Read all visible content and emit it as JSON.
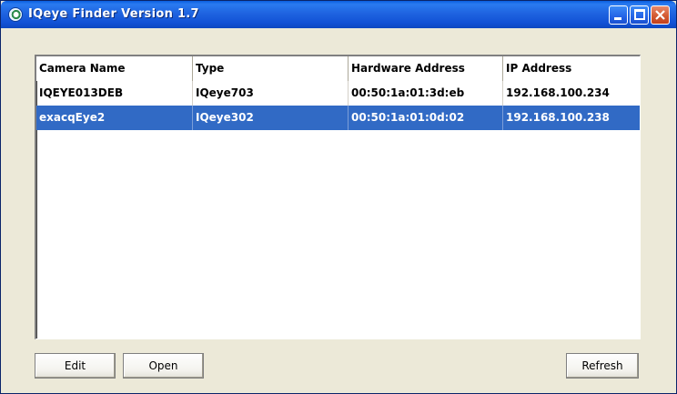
{
  "window": {
    "title": "IQeye  Finder Version 1.7"
  },
  "titlebar_icons": [
    "app-camera-icon",
    "minimize-icon",
    "maximize-icon",
    "close-icon"
  ],
  "table": {
    "columns": [
      "Camera Name",
      "Type",
      "Hardware Address",
      "IP Address"
    ],
    "rows": [
      {
        "name": "IQEYE013DEB",
        "type": "IQeye703",
        "hw": "00:50:1a:01:3d:eb",
        "ip": "192.168.100.234"
      },
      {
        "name": "exacqEye2",
        "type": "IQeye302",
        "hw": "00:50:1a:01:0d:02",
        "ip": "192.168.100.238"
      }
    ],
    "selected_row": 1
  },
  "buttons": {
    "edit": "Edit",
    "open": "Open",
    "refresh": "Refresh"
  },
  "colors": {
    "titlebar": "#1f64e0",
    "selection": "#316ac5",
    "face": "#ece9d8"
  }
}
